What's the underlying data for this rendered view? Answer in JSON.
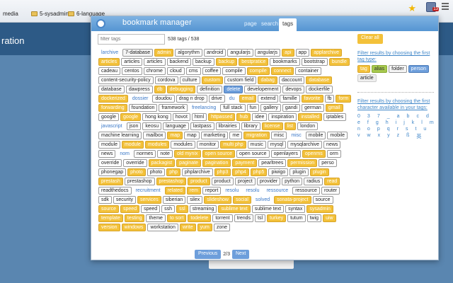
{
  "bookmarks_bar": [
    "media",
    "5-sysadmin",
    "6-language"
  ],
  "background": {
    "header_text": "ration"
  },
  "extension_badge": "13",
  "popup": {
    "title": "bookmark manager",
    "nav": {
      "page": "page",
      "search": "search",
      "tags": "tags"
    },
    "filter_placeholder": "filter tags",
    "tag_count": "538 tags / 538",
    "clear_all": "Clear all",
    "sidebar": {
      "type_heading": "Filter results by choosing the first tag type:",
      "types": [
        "tag",
        "alias",
        "folder",
        "person",
        "article"
      ],
      "char_heading": "Filter results by choosing the first character available in your tags:",
      "chars": [
        "0",
        "3",
        "7",
        "_",
        "a",
        "b",
        "c",
        "d",
        "e",
        "f",
        "g",
        "h",
        "i",
        "j",
        "k",
        "l",
        "m",
        "n",
        "o",
        "p",
        "q",
        "r",
        "s",
        "t",
        "u",
        "v",
        "w",
        "x",
        "y",
        "z",
        "ß",
        "英"
      ]
    },
    "pager": {
      "prev": "Previous",
      "page": "2/3",
      "next": "Next"
    },
    "tags": [
      {
        "t": "larchive",
        "k": "alias"
      },
      {
        "t": "7-database",
        "k": "folder"
      },
      {
        "t": "admin",
        "k": "custom"
      },
      {
        "t": "algorythm",
        "k": "plain"
      },
      {
        "t": "android",
        "k": "plain"
      },
      {
        "t": "angularjs",
        "k": "plain"
      },
      {
        "t": "angularjs",
        "k": "plain"
      },
      {
        "t": "api",
        "k": "custom"
      },
      {
        "t": "app",
        "k": "plain"
      },
      {
        "t": "applarchive",
        "k": "custom"
      },
      {
        "t": "articles",
        "k": "custom"
      },
      {
        "t": "articles",
        "k": "plain"
      },
      {
        "t": "articles",
        "k": "plain"
      },
      {
        "t": "backend",
        "k": "plain"
      },
      {
        "t": "backup",
        "k": "plain"
      },
      {
        "t": "backup",
        "k": "custom"
      },
      {
        "t": "bestpratice",
        "k": "custom"
      },
      {
        "t": "bookmarks",
        "k": "plain"
      },
      {
        "t": "bootstrap",
        "k": "plain"
      },
      {
        "t": "bundle",
        "k": "custom"
      },
      {
        "t": "cadeau",
        "k": "plain"
      },
      {
        "t": "centos",
        "k": "plain"
      },
      {
        "t": "chrome",
        "k": "plain"
      },
      {
        "t": "cloud",
        "k": "plain"
      },
      {
        "t": "cms",
        "k": "plain"
      },
      {
        "t": "coffee",
        "k": "plain"
      },
      {
        "t": "compile",
        "k": "plain"
      },
      {
        "t": "compile",
        "k": "custom"
      },
      {
        "t": "connect",
        "k": "custom"
      },
      {
        "t": "container",
        "k": "plain"
      },
      {
        "t": "content-security-policy",
        "k": "plain"
      },
      {
        "t": "cordova",
        "k": "plain"
      },
      {
        "t": "culture",
        "k": "plain"
      },
      {
        "t": "custom",
        "k": "custom"
      },
      {
        "t": "custom field",
        "k": "plain"
      },
      {
        "t": "dabag",
        "k": "custom"
      },
      {
        "t": "daccount",
        "k": "plain"
      },
      {
        "t": "database",
        "k": "custom"
      },
      {
        "t": "database",
        "k": "plain"
      },
      {
        "t": "dawpress",
        "k": "plain"
      },
      {
        "t": "db",
        "k": "custom"
      },
      {
        "t": "debugging",
        "k": "custom"
      },
      {
        "t": "definition",
        "k": "plain"
      },
      {
        "t": "delete",
        "k": "person"
      },
      {
        "t": "developement",
        "k": "plain"
      },
      {
        "t": "devops",
        "k": "plain"
      },
      {
        "t": "dockerfile",
        "k": "plain"
      },
      {
        "t": "dockerized",
        "k": "custom"
      },
      {
        "t": "dossier",
        "k": "alias"
      },
      {
        "t": "doudou",
        "k": "plain"
      },
      {
        "t": "drag n drop",
        "k": "plain"
      },
      {
        "t": "drive",
        "k": "plain"
      },
      {
        "t": "du",
        "k": "alias"
      },
      {
        "t": "email",
        "k": "custom"
      },
      {
        "t": "extend",
        "k": "plain"
      },
      {
        "t": "famille",
        "k": "plain"
      },
      {
        "t": "favorite",
        "k": "custom"
      },
      {
        "t": "fb",
        "k": "plain"
      },
      {
        "t": "form",
        "k": "custom"
      },
      {
        "t": "forwarding",
        "k": "custom"
      },
      {
        "t": "foundation",
        "k": "plain"
      },
      {
        "t": "framework",
        "k": "plain"
      },
      {
        "t": "freelancing",
        "k": "alias"
      },
      {
        "t": "full stack",
        "k": "plain"
      },
      {
        "t": "fun",
        "k": "plain"
      },
      {
        "t": "gallery",
        "k": "plain"
      },
      {
        "t": "gandi",
        "k": "plain"
      },
      {
        "t": "german",
        "k": "plain"
      },
      {
        "t": "gmail",
        "k": "custom"
      },
      {
        "t": "google",
        "k": "plain"
      },
      {
        "t": "google",
        "k": "custom"
      },
      {
        "t": "hong kong",
        "k": "plain"
      },
      {
        "t": "hovot",
        "k": "plain"
      },
      {
        "t": "html",
        "k": "plain"
      },
      {
        "t": "httpassed",
        "k": "custom"
      },
      {
        "t": "hub",
        "k": "custom"
      },
      {
        "t": "idee",
        "k": "plain"
      },
      {
        "t": "inspiration",
        "k": "plain"
      },
      {
        "t": "installed",
        "k": "custom"
      },
      {
        "t": "iptables",
        "k": "plain"
      },
      {
        "t": "javascript",
        "k": "alias"
      },
      {
        "t": "json",
        "k": "plain"
      },
      {
        "t": "keosu",
        "k": "plain"
      },
      {
        "t": "language",
        "k": "plain"
      },
      {
        "t": "lastpass",
        "k": "plain"
      },
      {
        "t": "librairies",
        "k": "plain"
      },
      {
        "t": "library",
        "k": "plain"
      },
      {
        "t": "license",
        "k": "custom"
      },
      {
        "t": "list",
        "k": "custom"
      },
      {
        "t": "london",
        "k": "plain"
      },
      {
        "t": "machine learning",
        "k": "plain"
      },
      {
        "t": "mailbox",
        "k": "plain"
      },
      {
        "t": "map",
        "k": "custom"
      },
      {
        "t": "map",
        "k": "plain"
      },
      {
        "t": "marketing",
        "k": "plain"
      },
      {
        "t": "me",
        "k": "plain"
      },
      {
        "t": "migration",
        "k": "custom"
      },
      {
        "t": "misc",
        "k": "plain"
      },
      {
        "t": "misc",
        "k": "alias"
      },
      {
        "t": "mobile",
        "k": "plain"
      },
      {
        "t": "mobile",
        "k": "plain"
      },
      {
        "t": "module",
        "k": "plain"
      },
      {
        "t": "module",
        "k": "custom"
      },
      {
        "t": "modules",
        "k": "custom"
      },
      {
        "t": "modules",
        "k": "plain"
      },
      {
        "t": "monitor",
        "k": "plain"
      },
      {
        "t": "multi php",
        "k": "custom"
      },
      {
        "t": "music",
        "k": "plain"
      },
      {
        "t": "mysql",
        "k": "plain"
      },
      {
        "t": "mysqlarchive",
        "k": "plain"
      },
      {
        "t": "news",
        "k": "plain"
      },
      {
        "t": "news",
        "k": "plain"
      },
      {
        "t": "nom",
        "k": "alias"
      },
      {
        "t": "normes",
        "k": "plain"
      },
      {
        "t": "note",
        "k": "plain"
      },
      {
        "t": "old mynix",
        "k": "custom"
      },
      {
        "t": "open source",
        "k": "custom"
      },
      {
        "t": "open source",
        "k": "plain"
      },
      {
        "t": "openlayers",
        "k": "plain"
      },
      {
        "t": "openms",
        "k": "custom"
      },
      {
        "t": "orm",
        "k": "plain"
      },
      {
        "t": "override",
        "k": "plain"
      },
      {
        "t": "override",
        "k": "plain"
      },
      {
        "t": "packagist",
        "k": "custom"
      },
      {
        "t": "paginate",
        "k": "custom"
      },
      {
        "t": "pagination",
        "k": "custom"
      },
      {
        "t": "payment",
        "k": "custom"
      },
      {
        "t": "pearltrees",
        "k": "plain"
      },
      {
        "t": "permission",
        "k": "custom"
      },
      {
        "t": "perso",
        "k": "plain"
      },
      {
        "t": "phonegap",
        "k": "plain"
      },
      {
        "t": "photo",
        "k": "custom"
      },
      {
        "t": "photo",
        "k": "plain"
      },
      {
        "t": "php",
        "k": "custom"
      },
      {
        "t": "phplarchive",
        "k": "plain"
      },
      {
        "t": "php3",
        "k": "custom"
      },
      {
        "t": "php4",
        "k": "custom"
      },
      {
        "t": "php5",
        "k": "custom"
      },
      {
        "t": "piwigo",
        "k": "plain"
      },
      {
        "t": "plugin",
        "k": "plain"
      },
      {
        "t": "plugin",
        "k": "custom"
      },
      {
        "t": "prestash",
        "k": "custom"
      },
      {
        "t": "prestashop",
        "k": "plain"
      },
      {
        "t": "prestashop",
        "k": "custom"
      },
      {
        "t": "product",
        "k": "custom"
      },
      {
        "t": "product",
        "k": "plain"
      },
      {
        "t": "project",
        "k": "plain"
      },
      {
        "t": "provider",
        "k": "plain"
      },
      {
        "t": "python",
        "k": "plain"
      },
      {
        "t": "radius",
        "k": "plain"
      },
      {
        "t": "read",
        "k": "custom"
      },
      {
        "t": "readthedocs",
        "k": "plain"
      },
      {
        "t": "recruitment",
        "k": "alias"
      },
      {
        "t": "related",
        "k": "custom"
      },
      {
        "t": "rem",
        "k": "custom"
      },
      {
        "t": "report",
        "k": "plain"
      },
      {
        "t": "resolu",
        "k": "alias"
      },
      {
        "t": "resolu",
        "k": "alias"
      },
      {
        "t": "ressource",
        "k": "alias"
      },
      {
        "t": "ressource",
        "k": "plain"
      },
      {
        "t": "router",
        "k": "plain"
      },
      {
        "t": "sdk",
        "k": "plain"
      },
      {
        "t": "security",
        "k": "plain"
      },
      {
        "t": "services",
        "k": "custom"
      },
      {
        "t": "siberian",
        "k": "plain"
      },
      {
        "t": "silex",
        "k": "plain"
      },
      {
        "t": "slideshow",
        "k": "custom"
      },
      {
        "t": "social",
        "k": "custom"
      },
      {
        "t": "solved",
        "k": "alias"
      },
      {
        "t": "sonata-project",
        "k": "custom"
      },
      {
        "t": "source",
        "k": "plain"
      },
      {
        "t": "source",
        "k": "custom"
      },
      {
        "t": "speed",
        "k": "custom"
      },
      {
        "t": "speed",
        "k": "plain"
      },
      {
        "t": "ssh",
        "k": "plain"
      },
      {
        "t": "ssl",
        "k": "custom"
      },
      {
        "t": "streaming",
        "k": "plain"
      },
      {
        "t": "sublime text",
        "k": "custom"
      },
      {
        "t": "sublime text",
        "k": "plain"
      },
      {
        "t": "syntax",
        "k": "plain"
      },
      {
        "t": "sysadmin",
        "k": "custom"
      },
      {
        "t": "template",
        "k": "custom"
      },
      {
        "t": "testing",
        "k": "custom"
      },
      {
        "t": "theme",
        "k": "plain"
      },
      {
        "t": "to sort",
        "k": "custom"
      },
      {
        "t": "todelete",
        "k": "custom"
      },
      {
        "t": "torrent",
        "k": "plain"
      },
      {
        "t": "trends",
        "k": "plain"
      },
      {
        "t": "tsl",
        "k": "plain"
      },
      {
        "t": "turkey",
        "k": "custom"
      },
      {
        "t": "tutum",
        "k": "plain"
      },
      {
        "t": "twig",
        "k": "plain"
      },
      {
        "t": "uiw",
        "k": "custom"
      },
      {
        "t": "version",
        "k": "custom"
      },
      {
        "t": "windows",
        "k": "custom"
      },
      {
        "t": "workstation",
        "k": "plain"
      },
      {
        "t": "write",
        "k": "custom"
      },
      {
        "t": "yum",
        "k": "custom"
      },
      {
        "t": "zone",
        "k": "plain"
      }
    ]
  }
}
